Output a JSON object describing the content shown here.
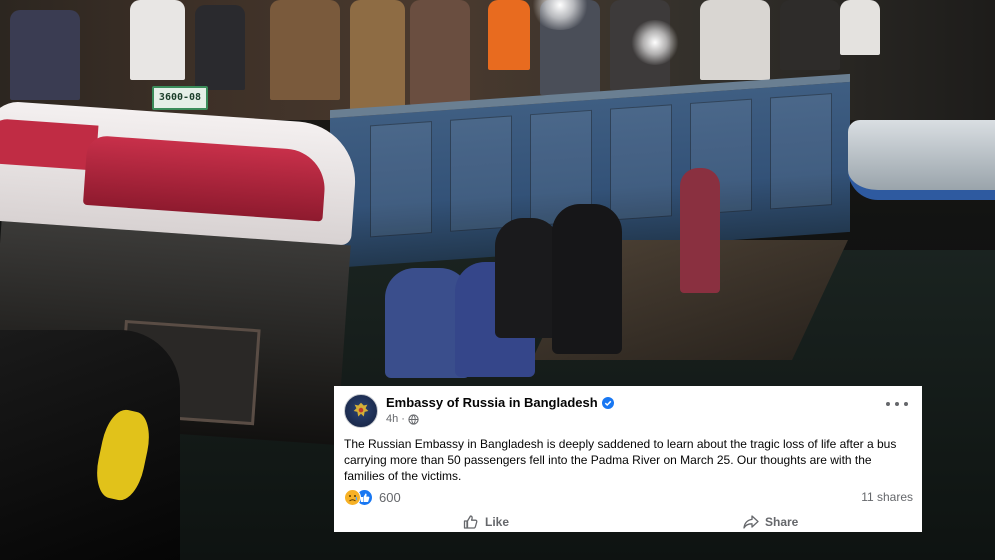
{
  "photo": {
    "plate_text": "3600-08"
  },
  "post": {
    "page_name": "Embassy of Russia in Bangladesh",
    "time": "4h",
    "separator": "·",
    "privacy_icon": "globe-icon",
    "more_icon": "more-options-icon",
    "body": "The Russian Embassy in Bangladesh is deeply saddened to learn about the tragic loss of life after a bus carrying more than 50 passengers fell into the Padma River on March 25. Our thoughts are with the families of the victims.",
    "reaction_icons": [
      "sad-reaction-icon",
      "like-reaction-icon"
    ],
    "reaction_count": "600",
    "shares": "11 shares",
    "actions": {
      "like_label": "Like",
      "share_label": "Share"
    }
  },
  "colors": {
    "verified_badge": "#1877f2",
    "like_reaction": "#1877f2",
    "sad_reaction": "#f7b125",
    "secondary_text": "#65676b",
    "primary_text": "#050505"
  }
}
